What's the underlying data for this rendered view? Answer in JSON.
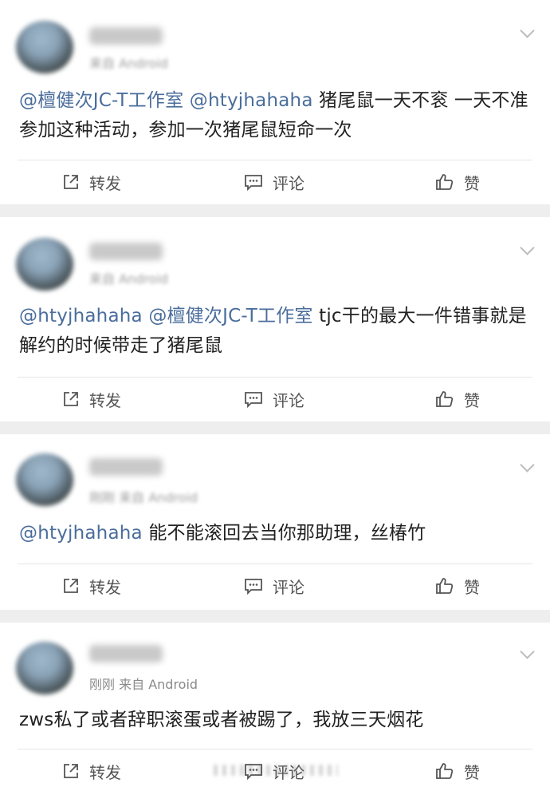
{
  "actions": {
    "repost": "转发",
    "comment": "评论",
    "like": "赞"
  },
  "posts": [
    {
      "time": "",
      "source": "来自 Android",
      "segments": [
        {
          "text": "@檀健次JC-T工作室",
          "mention": true
        },
        {
          "text": " ",
          "mention": false
        },
        {
          "text": "@htyjhahaha",
          "mention": true
        },
        {
          "text": " 猪尾鼠一天不衮 一天不准参加这种活动，参加一次猪尾鼠短命一次",
          "mention": false
        }
      ]
    },
    {
      "time": "",
      "source": "来自 Android",
      "segments": [
        {
          "text": "@htyjhahaha",
          "mention": true
        },
        {
          "text": " ",
          "mention": false
        },
        {
          "text": "@檀健次JC-T工作室",
          "mention": true
        },
        {
          "text": " tjc干的最大一件错事就是解约的时候带走了猪尾鼠",
          "mention": false
        }
      ]
    },
    {
      "time": "刚刚",
      "source": "来自 Android",
      "segments": [
        {
          "text": "@htyjhahaha",
          "mention": true
        },
        {
          "text": " 能不能滚回去当你那助理，丝椿竹",
          "mention": false
        }
      ]
    },
    {
      "time": "刚刚",
      "source": "来自 Android",
      "segments": [
        {
          "text": "zws私了或者辞职滚蛋或者被踢了，我放三天烟花",
          "mention": false
        }
      ]
    }
  ]
}
